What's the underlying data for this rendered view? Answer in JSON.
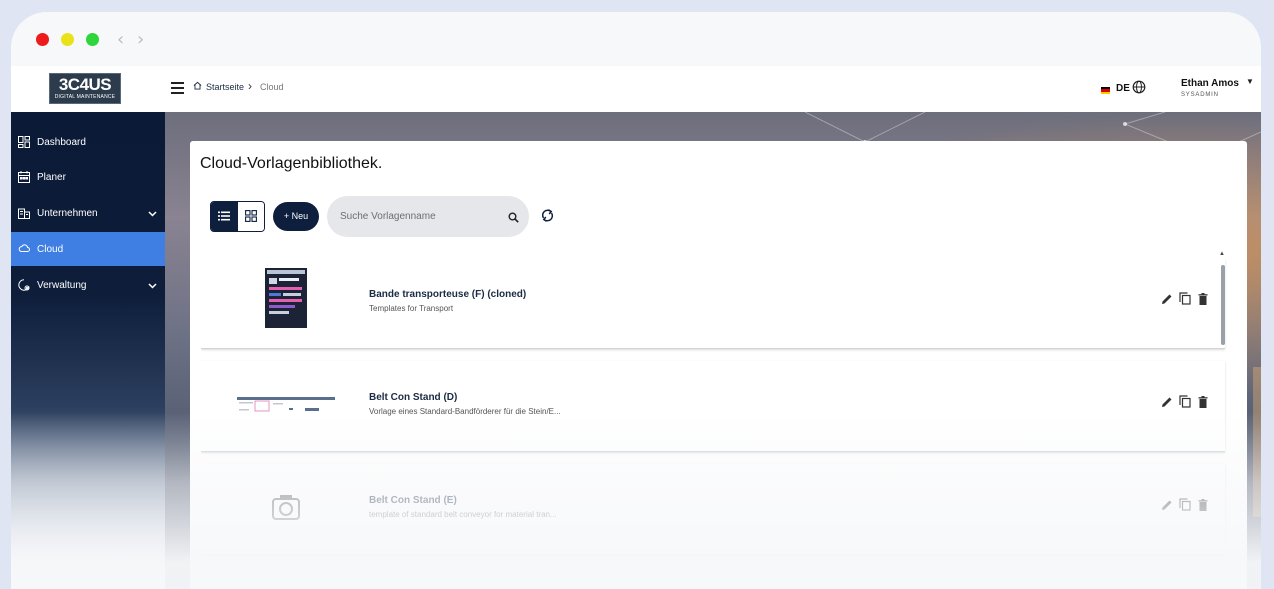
{
  "window": {
    "controls": [
      "close",
      "minimize",
      "maximize"
    ],
    "nav_back_glyph": "‹",
    "nav_forward_glyph": "›"
  },
  "header": {
    "logo_main": "3C4US",
    "logo_sub": "DIGITAL MAINTENANCE",
    "breadcrumb": {
      "home": "Startseite",
      "separator": "›",
      "current": "Cloud"
    },
    "language": "DE",
    "user": {
      "name": "Ethan Amos",
      "role": "SYSADMIN"
    }
  },
  "sidebar": {
    "items": [
      {
        "label": "Dashboard",
        "icon": "dashboard-icon"
      },
      {
        "label": "Planer",
        "icon": "calendar-icon"
      },
      {
        "label": "Unternehmen",
        "icon": "company-icon"
      },
      {
        "label": "Cloud",
        "icon": "cloud-icon"
      },
      {
        "label": "Verwaltung",
        "icon": "settings-icon"
      }
    ]
  },
  "main": {
    "title": "Cloud-Vorlagenbibliothek.",
    "new_button": "+ Neu",
    "search_placeholder": "Suche Vorlagenname",
    "templates": [
      {
        "title": "Bande transporteuse (F) (cloned)",
        "subtitle": "Templates for Transport"
      },
      {
        "title": "Belt Con Stand (D)",
        "subtitle": "Vorlage eines Standard-Bandförderer für die Stein/E..."
      },
      {
        "title": "Belt Con Stand (E)",
        "subtitle": "template of standard belt conveyor for material tran..."
      }
    ]
  },
  "colors": {
    "accent": "#3f7ee2",
    "navy": "#0d1f3d",
    "sidebar": "#0b1a36"
  }
}
